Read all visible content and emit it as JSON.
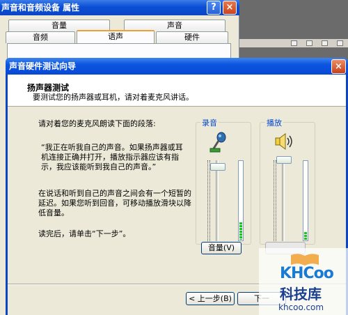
{
  "background_window": {
    "title": "声音和音频设备 属性",
    "help_glyph": "?",
    "close_glyph": "×",
    "tabs_row1": [
      "音量",
      "声音"
    ],
    "tabs_row2": [
      "音频",
      "语声",
      "硬件"
    ],
    "active_tab": "语声"
  },
  "wizard": {
    "title": "声音硬件测试向导",
    "close_glyph": "×",
    "header_title": "扬声器测试",
    "header_subtitle": "要测试您的扬声器或耳机，请对着麦克风讲话。",
    "instruction": "请对着您的麦克风朗读下面的段落:",
    "quote": "“我正在听我自己的声音。如果扬声器或耳机连接正确并打开，播放指示器应该有指示，我应该能听到我自己的声音。”",
    "delay_note": "在说话和听到自己的声音之间会有一个短暂的延迟。如果您听到回音，可移动播放滑块以降低音量。",
    "after_note": "读完后，请单击“下一步”。",
    "record_group": {
      "label": "录音",
      "icon": "microphone-icon",
      "level_fraction": 0.22
    },
    "playback_group": {
      "label": "播放",
      "icon": "speaker-icon",
      "level_fraction": 0.1
    },
    "volume_button": "音量(V)",
    "back_button": "< 上一步(B)",
    "next_button": "下一",
    "accent_colors": {
      "title_bar": "#0a46c4",
      "group_label": "#0046d5",
      "meter": "#18c818"
    }
  },
  "watermark": {
    "logo": "KHCoo",
    "name": "科技库",
    "url": "khcoo.com"
  }
}
